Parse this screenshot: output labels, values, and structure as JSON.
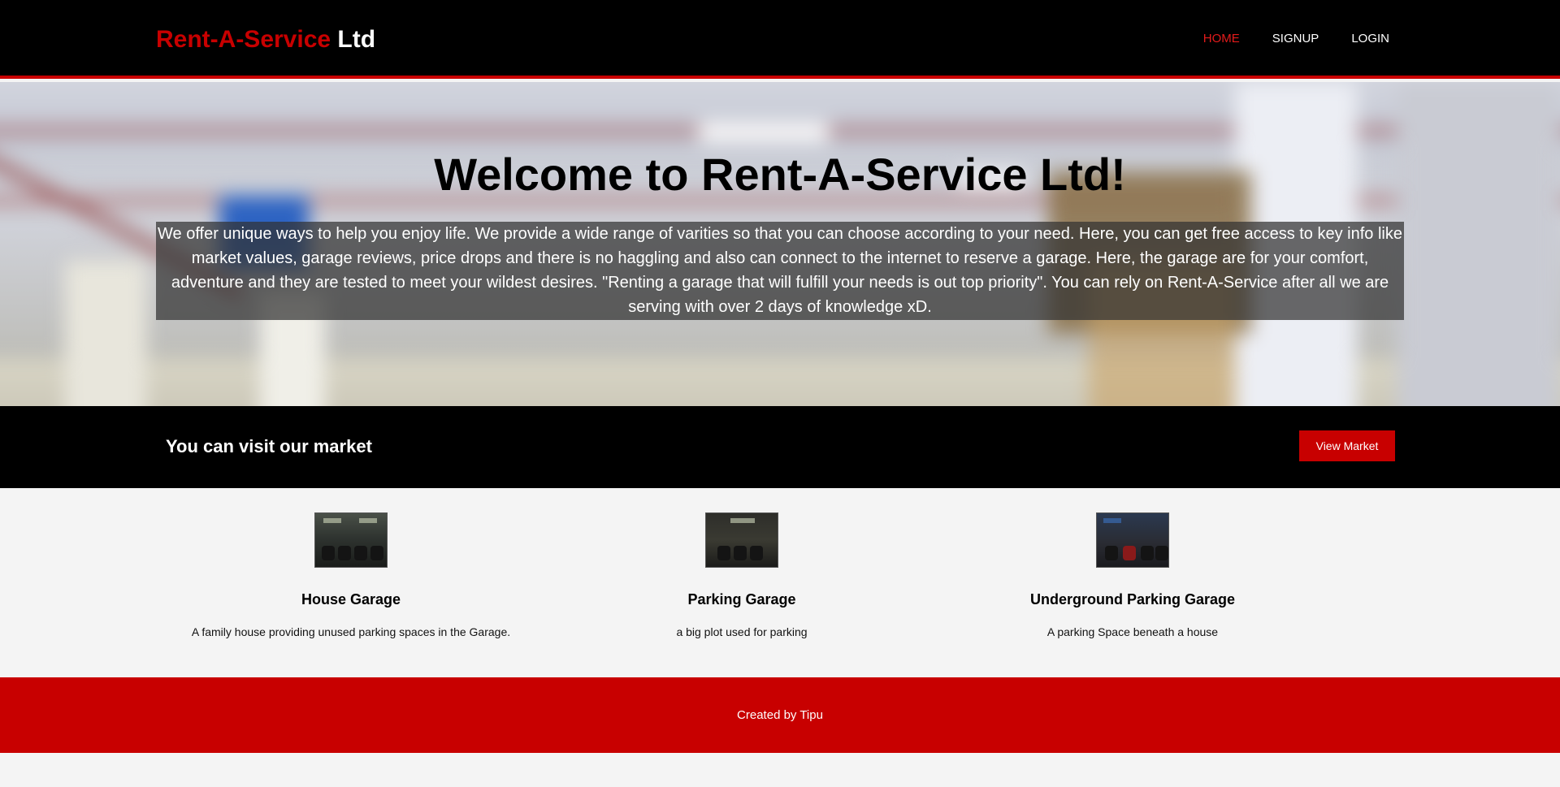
{
  "header": {
    "brand_red": "Rent-A-Service",
    "brand_white": "Ltd",
    "nav": [
      {
        "label": "HOME",
        "active": true
      },
      {
        "label": "SIGNUP",
        "active": false
      },
      {
        "label": "LOGIN",
        "active": false
      }
    ]
  },
  "hero": {
    "title": "Welcome to Rent-A-Service Ltd!",
    "text": "We offer unique ways to help you enjoy life. We provide a wide range of varities so that you can choose according to your need. Here, you can get free access to key info like market values, garage reviews, price drops and there is no haggling and also can connect to the internet to reserve a garage. Here, the garage are for your comfort, adventure and they are tested to meet your wildest desires. \"Renting a garage that will fulfill your needs is out top priority\". You can rely on Rent-A-Service after all we are serving with over 2 days of knowledge xD."
  },
  "market": {
    "title": "You can visit our market",
    "button_label": "View Market"
  },
  "cards": [
    {
      "title": "House Garage",
      "description": "A family house providing unused parking spaces in the Garage."
    },
    {
      "title": "Parking Garage",
      "description": "a big plot used for parking"
    },
    {
      "title": "Underground Parking Garage",
      "description": "A parking Space beneath a house"
    }
  ],
  "footer": {
    "text": "Created by Tipu"
  },
  "colors": {
    "brand_red": "#c80000",
    "nav_active": "#e31b1b",
    "header_bg": "#000000",
    "page_bg": "#f4f4f4"
  }
}
